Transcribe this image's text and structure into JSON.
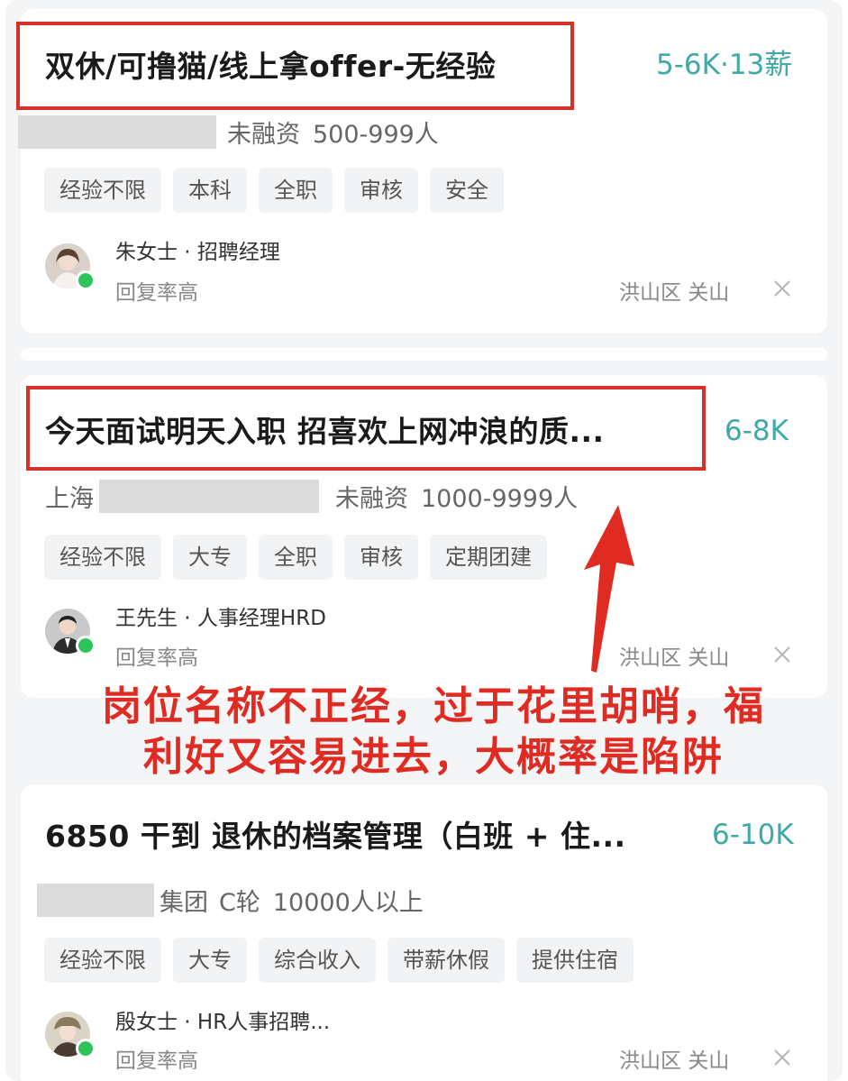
{
  "colors": {
    "salary": "#3fa9a6",
    "annotation_red": "#e02b22",
    "online_dot": "#2fc45a",
    "tag_bg": "#f2f3f5"
  },
  "jobs": [
    {
      "title": "双休/可撸猫/线上拿offer-无经验",
      "salary": "5-6K·13薪",
      "city": "",
      "funding": "未融资",
      "size": "500-999人",
      "tags": [
        "经验不限",
        "本科",
        "全职",
        "审核",
        "安全"
      ],
      "recruiter": "朱女士 · 招聘经理",
      "reply": "回复率高",
      "location": "洪山区 关山"
    },
    {
      "title": "今天面试明天入职 招喜欢上网冲浪的质...",
      "salary": "6-8K",
      "city": "上海",
      "funding": "未融资",
      "size": "1000-9999人",
      "tags": [
        "经验不限",
        "大专",
        "全职",
        "审核",
        "定期团建"
      ],
      "recruiter": "王先生 · 人事经理HRD",
      "reply": "回复率高",
      "location": "洪山区 关山"
    },
    {
      "title": "6850 干到 退休的档案管理（白班 + 住...",
      "salary": "6-10K",
      "city": "",
      "company_suffix": "集团",
      "funding": "C轮",
      "size": "10000人以上",
      "tags": [
        "经验不限",
        "大专",
        "综合收入",
        "带薪休假",
        "提供住宿"
      ],
      "recruiter": "殷女士 · HR人事招聘...",
      "reply": "回复率高",
      "location": "洪山区 关山"
    }
  ],
  "annotation": {
    "line1": "岗位名称不正经，过于花里胡哨，福",
    "line2": "利好又容易进去，大概率是陷阱"
  }
}
